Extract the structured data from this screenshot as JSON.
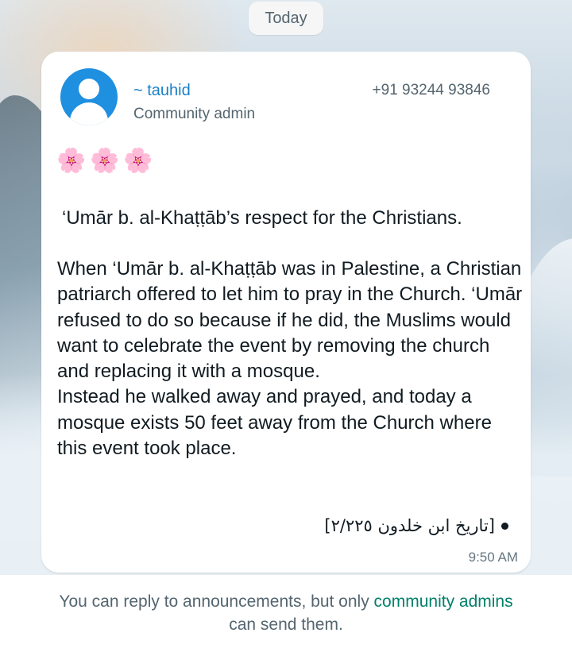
{
  "date_separator": "Today",
  "message": {
    "sender": {
      "name": "~ tauhid",
      "role": "Community admin",
      "phone": "+91 93244 93846"
    },
    "emoji": [
      "🌸",
      "🌸",
      "🌸"
    ],
    "heading": "‘Umār b. al-Khaṭṭāb’s respect for the Christians.",
    "body_paragraph_1": "When ‘Umār b. al-Khaṭṭāb was in Palestine, a Christian patriarch offered to let him to pray in the Church. ‘Umār refused to do so because if he did, the Muslims would want to celebrate the event by removing the church and replacing it with a mosque.",
    "body_paragraph_2": "Instead he walked away and prayed, and today a mosque exists 50 feet away from the Church where this event took place.",
    "citation": "[تاريخ ابن خلدون ٢/٢٢٥]",
    "time": "9:50 AM"
  },
  "footer": {
    "text_prefix": "You can reply to announcements, but only ",
    "link_text": "community admins",
    "text_suffix": "can send them."
  },
  "colors": {
    "sender_name": "#1a7fc4",
    "footer_link": "#008069",
    "avatar_bg": "#1f8fe0"
  }
}
